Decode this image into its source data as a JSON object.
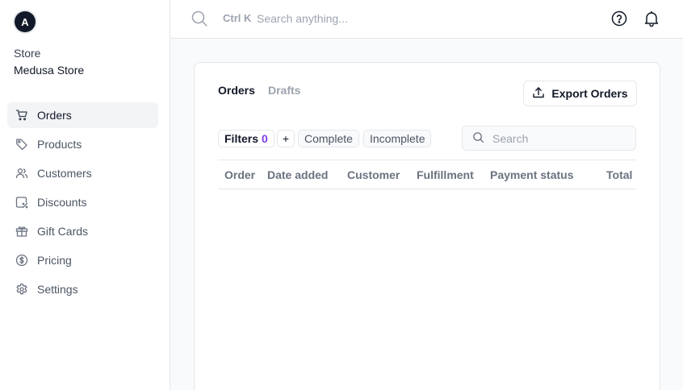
{
  "store": {
    "avatar_letter": "A",
    "label": "Store",
    "name": "Medusa Store"
  },
  "sidebar": {
    "items": [
      {
        "label": "Orders",
        "icon": "cart-icon",
        "active": true
      },
      {
        "label": "Products",
        "icon": "tag-icon"
      },
      {
        "label": "Customers",
        "icon": "users-icon"
      },
      {
        "label": "Discounts",
        "icon": "discount-icon"
      },
      {
        "label": "Gift Cards",
        "icon": "gift-icon"
      },
      {
        "label": "Pricing",
        "icon": "dollar-circle-icon"
      },
      {
        "label": "Settings",
        "icon": "gear-icon"
      }
    ]
  },
  "topbar": {
    "shortcut": "Ctrl K",
    "search_placeholder": "Search anything..."
  },
  "orders_page": {
    "tabs": [
      {
        "label": "Orders",
        "active": true
      },
      {
        "label": "Drafts",
        "active": false
      }
    ],
    "export_label": "Export Orders",
    "filters": {
      "label": "Filters",
      "count": "0",
      "add_label": "+",
      "presets": [
        "Complete",
        "Incomplete"
      ]
    },
    "search_placeholder": "Search",
    "table": {
      "columns": [
        "Order",
        "Date added",
        "Customer",
        "Fulfillment",
        "Payment status",
        "Total"
      ],
      "rows": []
    }
  },
  "colors": {
    "accent": "#7c3aed",
    "text": "#111827",
    "muted": "#6b7280",
    "border": "#e5e7eb"
  }
}
